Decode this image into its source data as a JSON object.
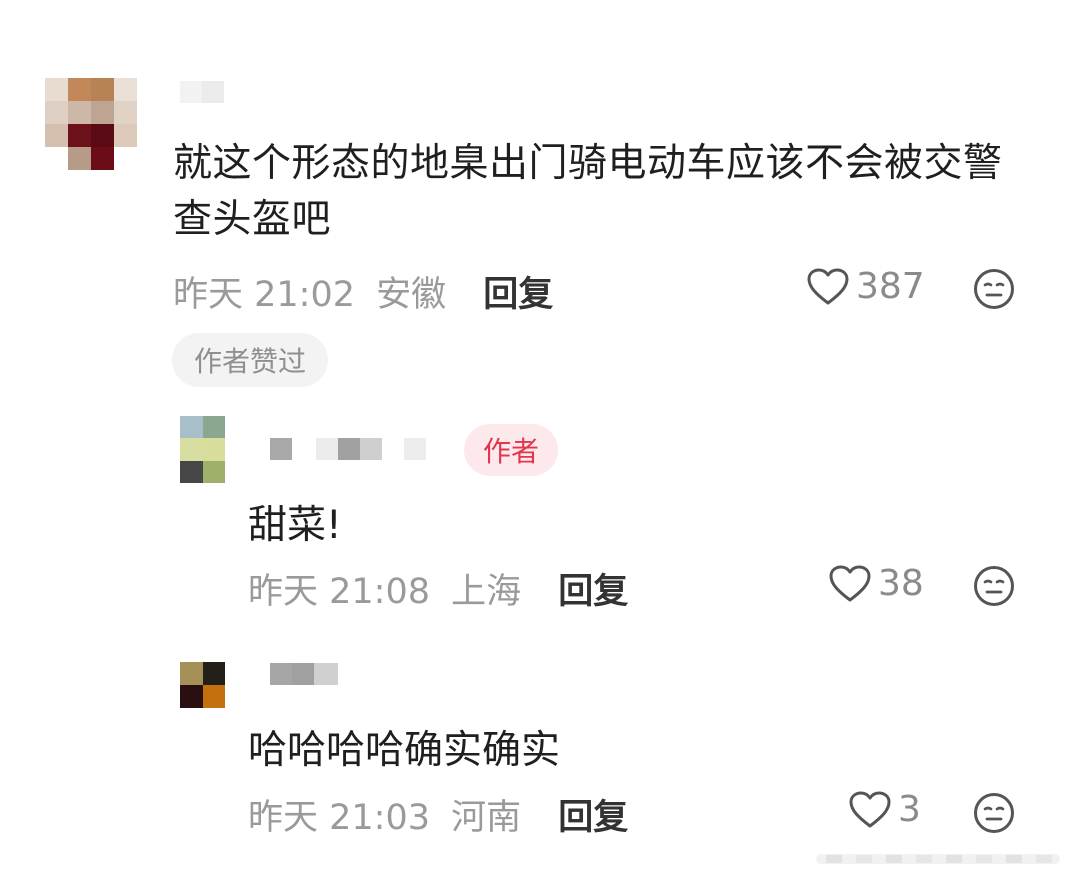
{
  "comment": {
    "text": "就这个形态的地臬出门骑电动车应该不会被交警查头盔吧",
    "time": "昨天 21:02",
    "location": "安徽",
    "reply_label": "回复",
    "likes": "387",
    "author_liked_label": "作者赞过"
  },
  "replies": [
    {
      "author_tag": "作者",
      "text": "甜菜!",
      "time": "昨天 21:08",
      "location": "上海",
      "reply_label": "回复",
      "likes": "38"
    },
    {
      "text": "哈哈哈哈确实确实",
      "time": "昨天 21:03",
      "location": "河南",
      "reply_label": "回复",
      "likes": "3"
    }
  ],
  "icons": {
    "like": "heart-outline-icon",
    "react": "neutral-face-icon"
  },
  "colors": {
    "author_tag_bg": "#fde9ec",
    "author_tag_text": "#e2364c",
    "meta_text": "#9a9a9a"
  }
}
